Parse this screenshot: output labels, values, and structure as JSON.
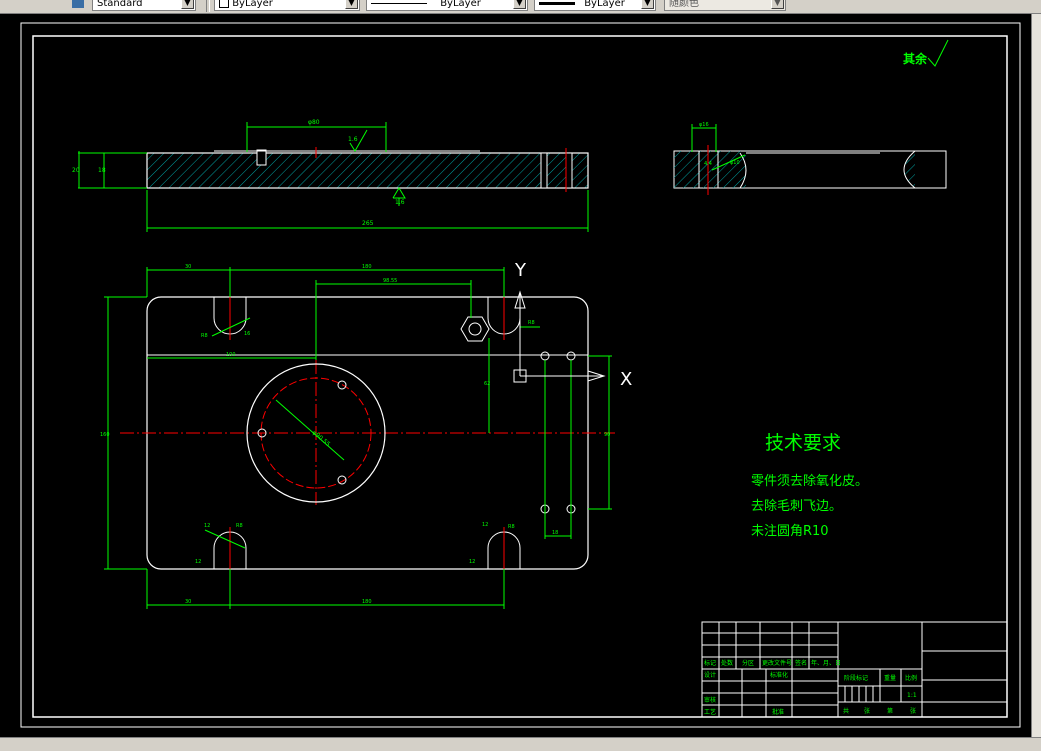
{
  "toolbar": {
    "text_style": "Standard",
    "layer": "ByLayer",
    "linetype": "ByLayer",
    "lineweight": "ByLayer",
    "plot_style": "随颜色"
  },
  "drawing": {
    "roughness_note": "其余",
    "side_top_dim": "φ80",
    "side_left_dim_1": "20",
    "side_left_dim_2": "18",
    "side_surface_finish_top": "1.6",
    "side_surface_finish_bottom": "1.6",
    "side_total_length": "265",
    "end_top_dim": "φ16",
    "end_dim_1": "4.4",
    "end_dim_2": "φ10",
    "plan_dim_top_left": "30",
    "plan_dim_top_mid": "180",
    "plan_dim_top_inner": "98.55",
    "plan_dim_left_height": "160",
    "plan_dim_mid_left": "100",
    "plan_dim_circle": "φ90.55",
    "plan_dim_hole_offset": "62",
    "plan_dim_right_height": "90",
    "plan_dim_slot_r": "R8",
    "plan_dim_slot_w": "16",
    "plan_dim_slot_bl_1": "12",
    "plan_dim_slot_bl_2": "R8",
    "plan_dim_bottom_left": "30",
    "plan_dim_bottom_mid": "180",
    "plan_dim_bottom_small": "12",
    "plan_dim_bottom_right_small": "12",
    "plan_dim_right_bottom": "18",
    "axis_y": "Y",
    "axis_x": "X"
  },
  "tech_req": {
    "title": "技术要求",
    "line1": "零件须去除氧化皮。",
    "line2": "去除毛刺飞边。",
    "line3": "未注圆角R10"
  },
  "title_block": {
    "row_labels": [
      "标记",
      "处数",
      "分区",
      "更改文件号",
      "签名",
      "年、月、日"
    ],
    "design": "设计",
    "standardize": "标准化",
    "stage_mark": "阶段标记",
    "weight": "重量",
    "scale": "比例",
    "scale_value": "1:1",
    "review": "审核",
    "process": "工艺",
    "approve": "批准",
    "sheets": "共",
    "sheet_word": "张",
    "page": "第",
    "page_word": "张"
  }
}
